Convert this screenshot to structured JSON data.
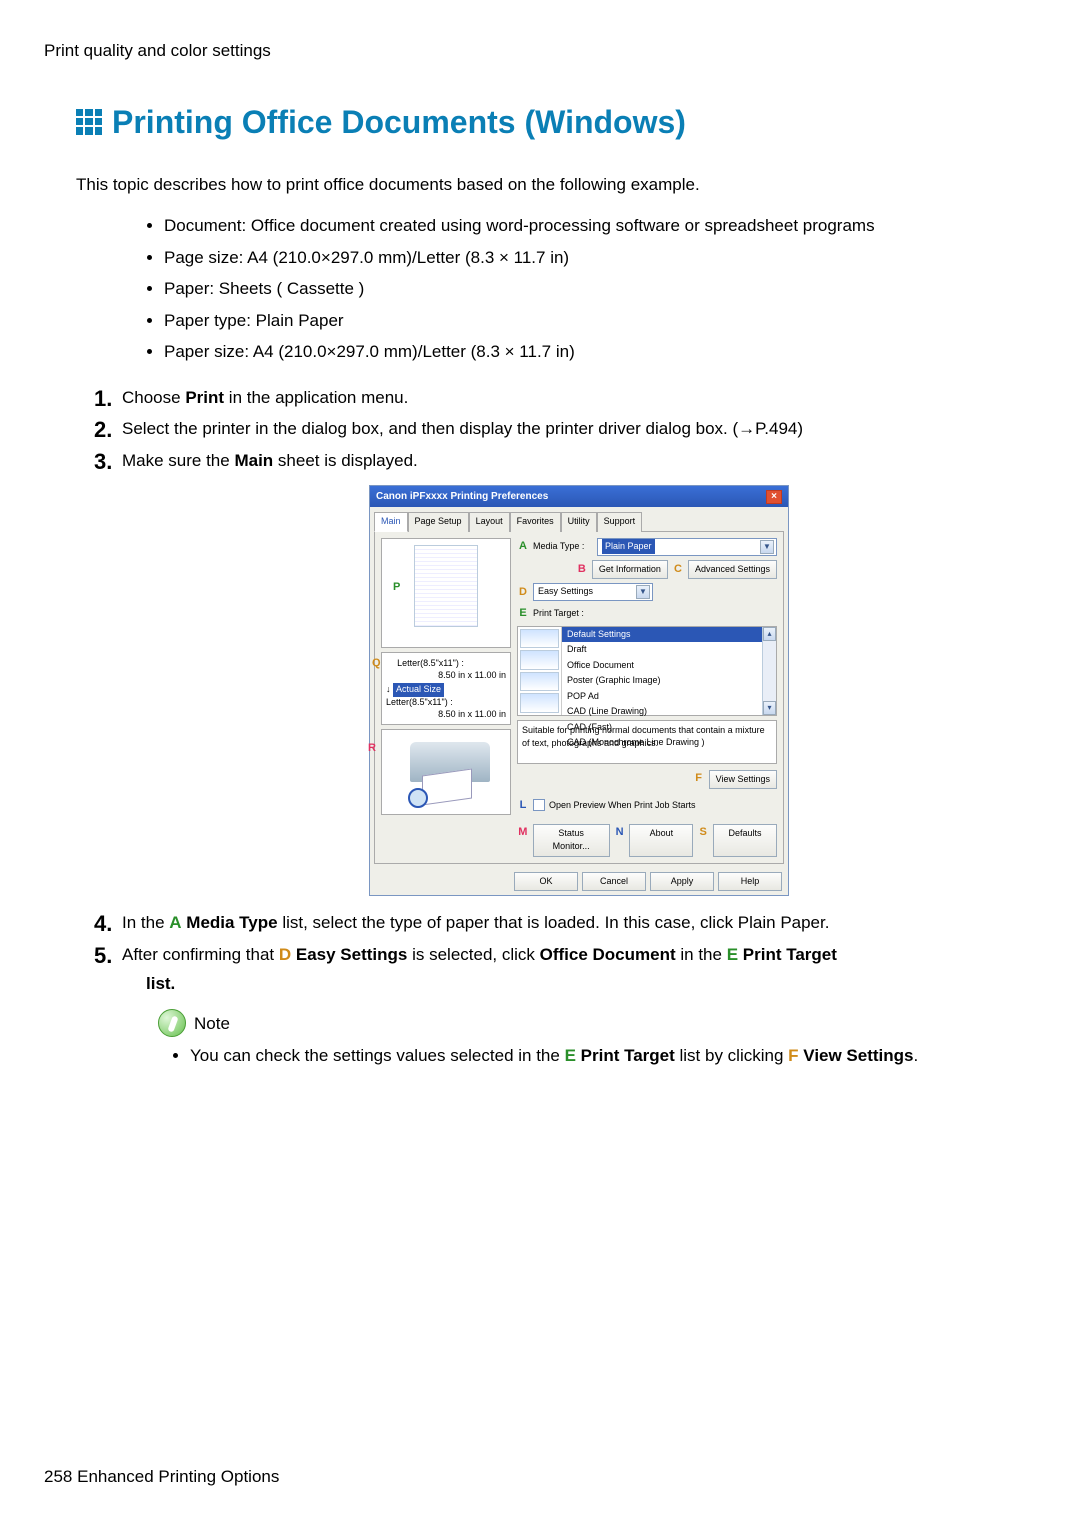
{
  "section_header": "Print quality and color settings",
  "title": "Printing Ofﬁce Documents (Windows)",
  "intro": "This topic describes how to print ofﬁce documents based on the following example.",
  "spec": [
    "Document: Ofﬁce document created using word-processing software or spreadsheet programs",
    "Page size: A4 (210.0×297.0 mm)/Letter (8.3 × 11.7 in)",
    "Paper: Sheets ( Cassette )",
    "Paper type: Plain Paper",
    "Paper size: A4 (210.0×297.0 mm)/Letter (8.3 × 11.7 in)"
  ],
  "steps": {
    "s1": {
      "pre": "Choose ",
      "kw": "Print",
      "post": " in the application menu."
    },
    "s2": "Select the printer in the dialog box, and then display the printer driver dialog box. (→P.494)",
    "s3": {
      "pre": "Make sure the ",
      "kw": "Main",
      "post": " sheet is displayed."
    },
    "s4": {
      "pre": "In the ",
      "marker": "A",
      "kw": "Media Type",
      "mid": " list, select the type of paper that is loaded. In this case, click Plain Paper."
    },
    "s5": {
      "pre": "After conﬁrming that ",
      "m1": "D",
      "kw1": "Easy Settings",
      "mid1": " is selected, click ",
      "kw2": "Ofﬁce Document",
      "mid2": " in the ",
      "m2": "E",
      "kw3": "Print Target",
      "post": " list."
    }
  },
  "dialog": {
    "title": "Canon iPFxxxx Printing Preferences",
    "tabs": [
      "Main",
      "Page Setup",
      "Layout",
      "Favorites",
      "Utility",
      "Support"
    ],
    "media_type_label": "Media Type :",
    "media_type_value": "Plain Paper",
    "get_info": "Get Information",
    "adv": "Advanced Settings",
    "easy_label": "Easy Settings",
    "print_target_label": "Print Target :",
    "targets": [
      "Default Settings",
      "Draft",
      "Office Document",
      "Poster (Graphic Image)",
      "POP Ad",
      "CAD (Line Drawing)",
      "CAD (Fast)",
      "CAD (Monochrome Line Drawing )"
    ],
    "desc": "Suitable for printing normal documents that contain a mixture of text, photographs and graphics.",
    "view_settings": "View Settings",
    "open_preview": "Open Preview When Print Job Starts",
    "status_monitor": "Status Monitor...",
    "about": "About",
    "defaults": "Defaults",
    "ok": "OK",
    "cancel": "Cancel",
    "apply": "Apply",
    "help": "Help",
    "letter1": "Letter(8.5\"x11\") :",
    "letter_dim": "8.50 in x 11.00 in",
    "actual": "Actual Size",
    "markers": {
      "P": "P",
      "Q": "Q",
      "R": "R",
      "A": "A",
      "B": "B",
      "C": "C",
      "D": "D",
      "E": "E",
      "F": "F",
      "L": "L",
      "M": "M",
      "N": "N",
      "S": "S"
    }
  },
  "note_label": "Note",
  "note_item": {
    "pre": "You can check the settings values selected in the ",
    "m1": "E",
    "kw1": "Print Target",
    "mid": " list by clicking ",
    "m2": "F",
    "kw2": "View Settings",
    "post": "."
  },
  "footer": {
    "page": "258",
    "chapter": "Enhanced Printing Options"
  }
}
